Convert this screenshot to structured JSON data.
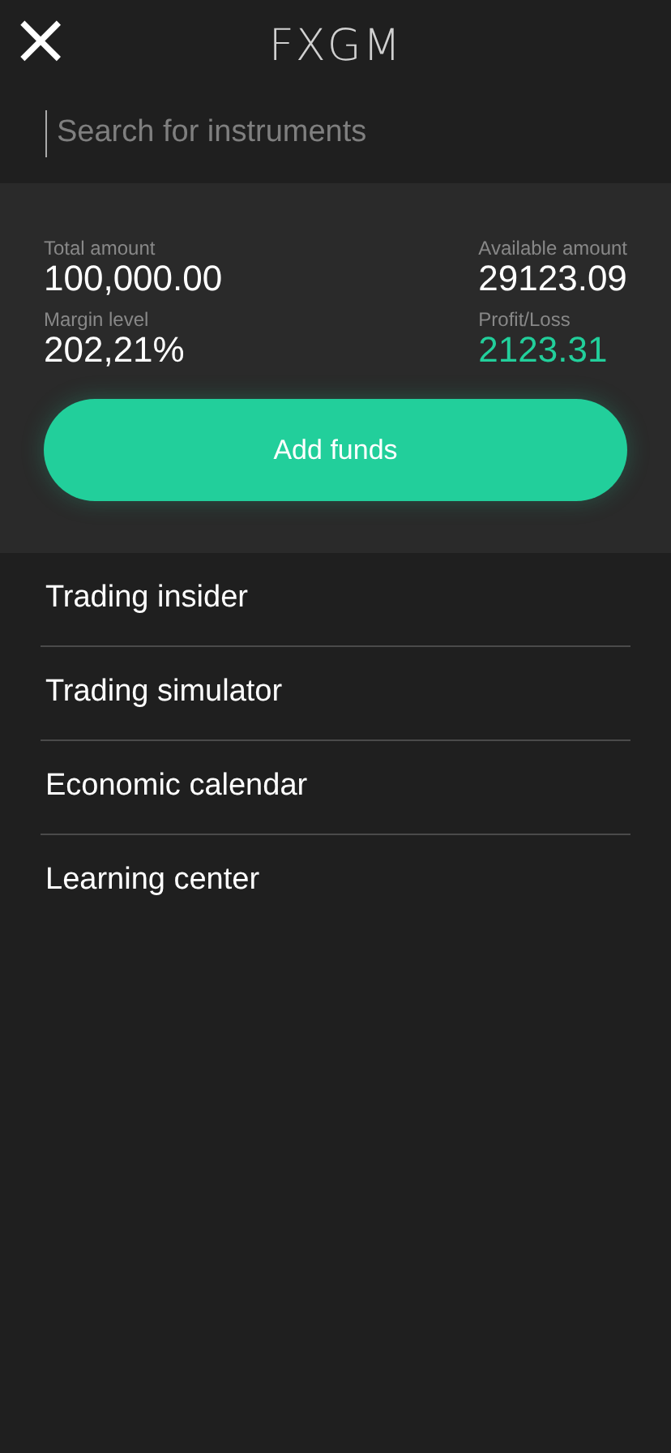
{
  "header": {
    "close_icon": "×",
    "logo": "FXGM"
  },
  "search": {
    "placeholder": "Search for instruments"
  },
  "account": {
    "stats": [
      {
        "label": "Total amount",
        "value": "100,000.00",
        "color": "#ffffff"
      },
      {
        "label": "Available amount",
        "value": "29123.09",
        "color": "#ffffff"
      },
      {
        "label": "Margin level",
        "value": "202,21%",
        "color": "#ffffff"
      },
      {
        "label": "Profit/Loss",
        "value": "2123.31",
        "color": "#22cf9b"
      }
    ],
    "button": "Add funds"
  },
  "menu": [
    {
      "label": "Trading insider"
    },
    {
      "label": "Trading simulator"
    },
    {
      "label": "Economic calendar"
    },
    {
      "label": "Learning center"
    }
  ]
}
